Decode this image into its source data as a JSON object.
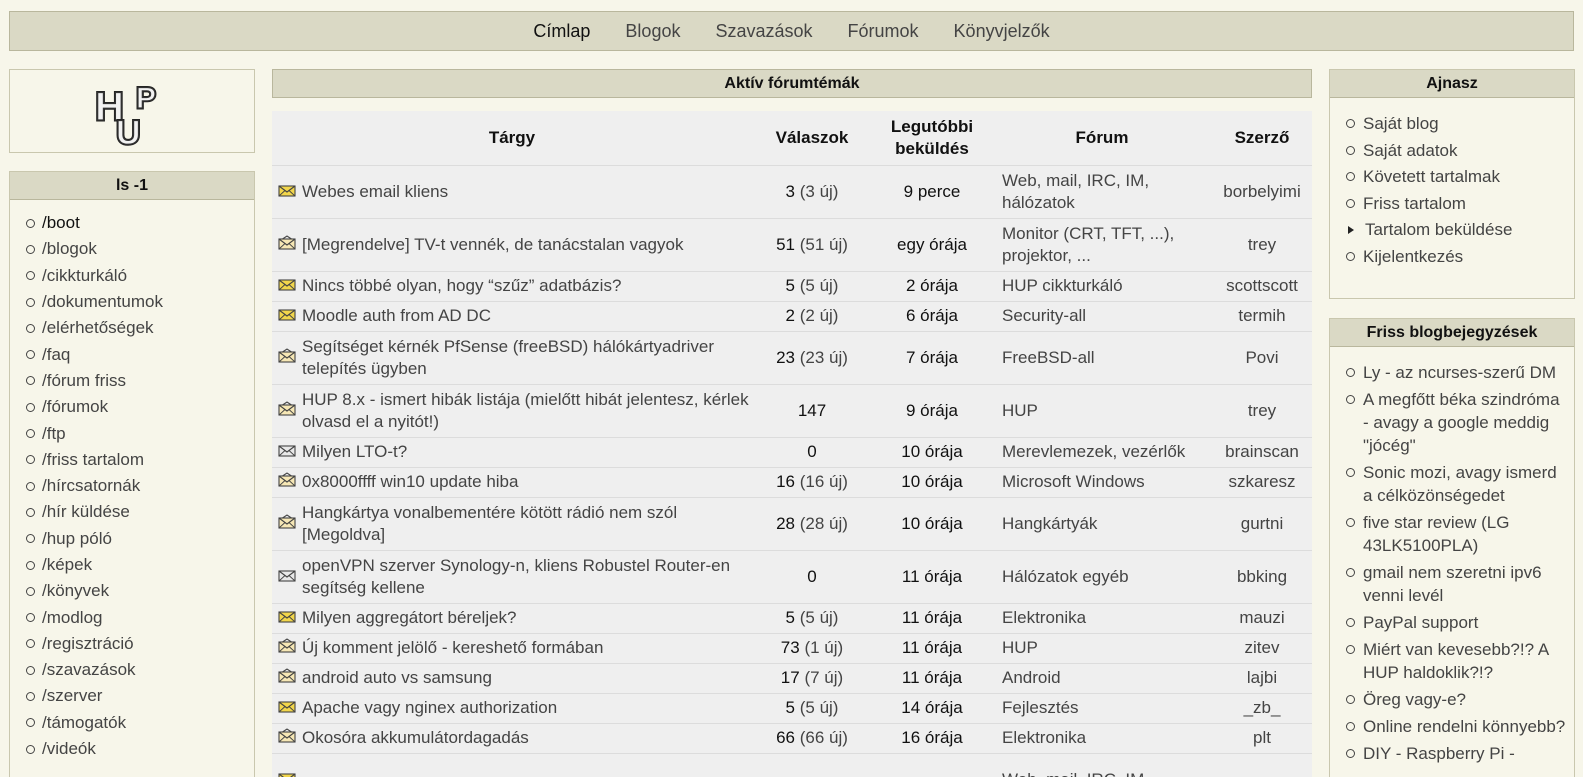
{
  "nav": {
    "items": [
      {
        "label": "Címlap",
        "active": true
      },
      {
        "label": "Blogok"
      },
      {
        "label": "Szavazások"
      },
      {
        "label": "Fórumok"
      },
      {
        "label": "Könyvjelzők"
      }
    ]
  },
  "logo": {
    "text": "HUP"
  },
  "left_menu": {
    "title": "ls -1",
    "items": [
      "/boot",
      "/blogok",
      "/cikkturkáló",
      "/dokumentumok",
      "/elérhetőségek",
      "/faq",
      "/fórum friss",
      "/fórumok",
      "/ftp",
      "/friss tartalom",
      "/hírcsatornák",
      "/hír küldése",
      "/hup póló",
      "/képek",
      "/könyvek",
      "/modlog",
      "/regisztráció",
      "/szavazások",
      "/szerver",
      "/támogatók",
      "/videók"
    ]
  },
  "forum": {
    "title": "Aktív fórumtémák",
    "headers": {
      "subject": "Tárgy",
      "replies": "Válaszok",
      "last": "Legutóbbi beküldés",
      "forum": "Fórum",
      "author": "Szerző"
    },
    "rows": [
      {
        "icon": "new",
        "subject": "Webes email kliens",
        "replies": "3",
        "new": "(3 új)",
        "last": "9 perce",
        "forum": "Web, mail, IRC, IM, hálózatok",
        "author": "borbelyimi",
        "tall": true
      },
      {
        "icon": "hot",
        "subject": "[Megrendelve] TV-t vennék, de tanácstalan vagyok",
        "replies": "51",
        "new": "(51 új)",
        "last": "egy órája",
        "forum": "Monitor (CRT, TFT, ...), projektor, ...",
        "author": "trey",
        "tall": true
      },
      {
        "icon": "new",
        "subject": "Nincs többé olyan, hogy “szűz” adatbázis?",
        "replies": "5",
        "new": "(5 új)",
        "last": "2 órája",
        "forum": "HUP cikkturkáló",
        "author": "scottscott"
      },
      {
        "icon": "new",
        "subject": "Moodle auth from AD DC",
        "replies": "2",
        "new": "(2 új)",
        "last": "6 órája",
        "forum": "Security-all",
        "author": "termih"
      },
      {
        "icon": "hot",
        "subject": "Segítséget kérnék PfSense (freeBSD) hálókártyadriver telepítés ügyben",
        "replies": "23",
        "new": "(23 új)",
        "last": "7 órája",
        "forum": "FreeBSD-all",
        "author": "Povi",
        "tall": true
      },
      {
        "icon": "hot",
        "subject": "HUP 8.x - ismert hibák listája (mielőtt hibát jelentesz, kérlek olvasd el a nyitót!)",
        "replies": "147",
        "new": "",
        "last": "9 órája",
        "forum": "HUP",
        "author": "trey",
        "tall": true
      },
      {
        "icon": "read",
        "subject": "Milyen LTO-t?",
        "replies": "0",
        "new": "",
        "last": "10 órája",
        "forum": "Merevlemezek, vezérlők",
        "author": "brainscan"
      },
      {
        "icon": "hot",
        "subject": "0x8000ffff win10 update hiba",
        "replies": "16",
        "new": "(16 új)",
        "last": "10 órája",
        "forum": "Microsoft Windows",
        "author": "szkaresz"
      },
      {
        "icon": "hot",
        "subject": "Hangkártya vonalbementére kötött rádió nem szól [Megoldva]",
        "replies": "28",
        "new": "(28 új)",
        "last": "10 órája",
        "forum": "Hangkártyák",
        "author": "gurtni",
        "tall": true
      },
      {
        "icon": "read",
        "subject": "openVPN szerver Synology-n, kliens Robustel Router-en segítség kellene",
        "replies": "0",
        "new": "",
        "last": "11 órája",
        "forum": "Hálózatok egyéb",
        "author": "bbking",
        "tall": true
      },
      {
        "icon": "new",
        "subject": "Milyen aggregátort béreljek?",
        "replies": "5",
        "new": "(5 új)",
        "last": "11 órája",
        "forum": "Elektronika",
        "author": "mauzi"
      },
      {
        "icon": "hot",
        "subject": "Új komment jelölő - kereshető formában",
        "replies": "73",
        "new": "(1 új)",
        "last": "11 órája",
        "forum": "HUP",
        "author": "zitev"
      },
      {
        "icon": "hot",
        "subject": "android auto vs samsung",
        "replies": "17",
        "new": "(7 új)",
        "last": "11 órája",
        "forum": "Android",
        "author": "lajbi"
      },
      {
        "icon": "new",
        "subject": "Apache vagy nginex authorization",
        "replies": "5",
        "new": "(5 új)",
        "last": "14 órája",
        "forum": "Fejlesztés",
        "author": "_zb_"
      },
      {
        "icon": "hot",
        "subject": "Okosóra akkumulátordagadás",
        "replies": "66",
        "new": "(66 új)",
        "last": "16 órája",
        "forum": "Elektronika",
        "author": "plt"
      },
      {
        "icon": "new",
        "subject": "",
        "replies": "",
        "new": "",
        "last": "",
        "forum": "Web, mail, IRC, IM",
        "author": "",
        "tall": true
      }
    ]
  },
  "user_box": {
    "title": "Ajnasz",
    "items": [
      {
        "label": "Saját blog"
      },
      {
        "label": "Saját adatok"
      },
      {
        "label": "Követett tartalmak"
      },
      {
        "label": "Friss tartalom"
      },
      {
        "label": "Tartalom beküldése",
        "expandable": true
      },
      {
        "label": "Kijelentkezés"
      }
    ]
  },
  "blog_box": {
    "title": "Friss blogbejegyzések",
    "items": [
      "Ly - az ncurses-szerű DM",
      "A megfőtt béka szindróma - avagy a google meddig \"jócég\"",
      "Sonic mozi, avagy ismerd a célközönségedet",
      "five star review (LG 43LK5100PLA)",
      "gmail nem szeretni ipv6 venni levél",
      "PayPal support",
      "Miért van kevesebb?!? A HUP haldoklik?!?",
      "Öreg vagy-e?",
      "Online rendelni könnyebb?",
      "DIY - Raspberry Pi -"
    ]
  },
  "colors": {
    "bar_bg": "#dad9c5",
    "page_bg": "#f7f6ea",
    "table_bg": "#efefef",
    "envelope_new": "#f2d64b"
  }
}
